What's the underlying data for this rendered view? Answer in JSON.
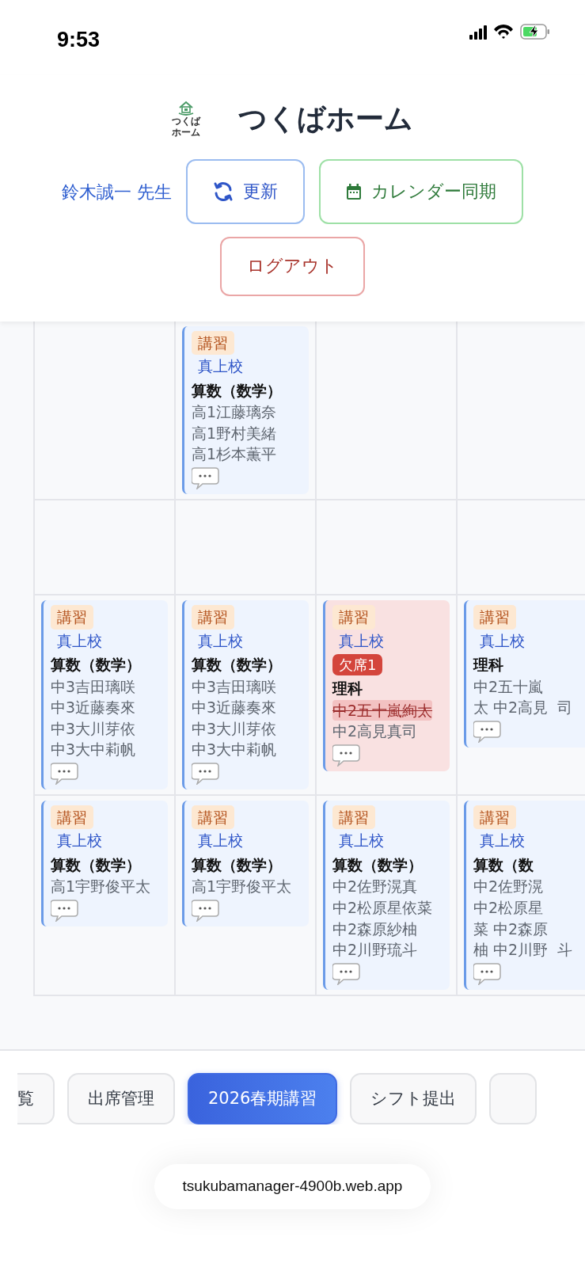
{
  "status_bar": {
    "time": "9:53"
  },
  "header": {
    "logo_lines": [
      "つくば",
      "ホーム"
    ],
    "title": "つくばホーム",
    "teacher": "鈴木誠一 先生",
    "buttons": [
      {
        "label": "更新",
        "kind": "refresh"
      },
      {
        "label": "カレンダー同期",
        "kind": "calendar"
      },
      {
        "label": "ログアウト",
        "kind": "logout"
      }
    ]
  },
  "schedule": {
    "rows": [
      {
        "cells": [
          {
            "kind": "empty"
          },
          {
            "kind": "lesson",
            "tag": "講習",
            "campus": "真上校",
            "subject": "算数（数学）",
            "students": [
              {
                "name": "高1江藤璃奈",
                "absent": false
              },
              {
                "name": "高1野村美緒",
                "absent": false
              },
              {
                "name": "高1杉本薫平",
                "absent": false
              }
            ]
          },
          {
            "kind": "empty"
          },
          {
            "kind": "empty"
          }
        ]
      },
      {
        "cells": [
          {
            "kind": "empty"
          },
          {
            "kind": "empty"
          },
          {
            "kind": "empty"
          },
          {
            "kind": "empty"
          }
        ]
      },
      {
        "cells": [
          {
            "kind": "lesson",
            "tag": "講習",
            "campus": "真上校",
            "subject": "算数（数学）",
            "students": [
              {
                "name": "中3吉田璃咲",
                "absent": false
              },
              {
                "name": "中3近藤奏來",
                "absent": false
              },
              {
                "name": "中3大川芽依",
                "absent": false
              },
              {
                "name": "中3大中莉帆",
                "absent": false
              }
            ]
          },
          {
            "kind": "lesson",
            "tag": "講習",
            "campus": "真上校",
            "subject": "算数（数学）",
            "students": [
              {
                "name": "中3吉田璃咲",
                "absent": false
              },
              {
                "name": "中3近藤奏來",
                "absent": false
              },
              {
                "name": "中3大川芽依",
                "absent": false
              },
              {
                "name": "中3大中莉帆",
                "absent": false
              }
            ]
          },
          {
            "kind": "lesson",
            "tag": "講習",
            "campus": "真上校",
            "absent_badge": "欠席1",
            "subject": "理科",
            "students": [
              {
                "name": "中2五十嵐絢太",
                "absent": true
              },
              {
                "name": "中2高見真司",
                "absent": false
              }
            ]
          },
          {
            "kind": "lesson",
            "tag": "講習",
            "campus": "真上校",
            "subject": "理科",
            "students": [
              {
                "name": "中2五十嵐",
                "absent": false
              },
              {
                "name": "太 中2高見",
                "absent": false
              },
              {
                "name": "司",
                "absent": false
              }
            ]
          }
        ]
      },
      {
        "cells": [
          {
            "kind": "lesson",
            "tag": "講習",
            "campus": "真上校",
            "subject": "算数（数学）",
            "students": [
              {
                "name": "高1宇野俊平太",
                "absent": false
              }
            ]
          },
          {
            "kind": "lesson",
            "tag": "講習",
            "campus": "真上校",
            "subject": "算数（数学）",
            "students": [
              {
                "name": "高1宇野俊平太",
                "absent": false
              }
            ]
          },
          {
            "kind": "lesson",
            "tag": "講習",
            "campus": "真上校",
            "subject": "算数（数学）",
            "students": [
              {
                "name": "中2佐野滉真",
                "absent": false
              },
              {
                "name": "中2松原星依菜",
                "absent": false
              },
              {
                "name": "中2森原紗柚",
                "absent": false
              },
              {
                "name": "中2川野琉斗",
                "absent": false
              }
            ]
          },
          {
            "kind": "lesson",
            "tag": "講習",
            "campus": "真上校",
            "subject": "算数（数",
            "students": [
              {
                "name": "中2佐野滉",
                "absent": false
              },
              {
                "name": "中2松原星",
                "absent": false
              },
              {
                "name": "菜 中2森原",
                "absent": false
              },
              {
                "name": "柚 中2川野",
                "absent": false
              },
              {
                "name": "斗",
                "absent": false
              }
            ]
          }
        ]
      }
    ]
  },
  "bottom_tabs": [
    {
      "label": "覧",
      "selected": false
    },
    {
      "label": "出席管理",
      "selected": false
    },
    {
      "label": "2026春期講習",
      "selected": true
    },
    {
      "label": "シフト提出",
      "selected": false
    },
    {
      "selected": false
    }
  ],
  "url_bar": {
    "address": "tsukubamanager-4900b.web.app"
  }
}
